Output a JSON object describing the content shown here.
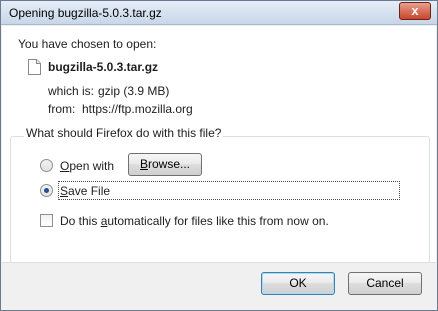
{
  "window": {
    "title": "Opening bugzilla-5.0.3.tar.gz",
    "close_glyph": "x"
  },
  "intro": "You have chosen to open:",
  "file": {
    "name": "bugzilla-5.0.3.tar.gz",
    "which_is_label": "which is:",
    "which_is_value": "gzip (3.9 MB)",
    "from_label": "from:",
    "from_value": "https://ftp.mozilla.org"
  },
  "action_group": {
    "legend": "What should Firefox do with this file?",
    "open_with": {
      "first": "O",
      "rest": "pen with",
      "selected": false
    },
    "browse_button": {
      "first": "B",
      "rest": "rowse..."
    },
    "save_file": {
      "first": "S",
      "rest": "ave File",
      "selected": true
    },
    "auto_checkbox": {
      "before": "Do this ",
      "accel": "a",
      "after": "utomatically for files like this from now on.",
      "checked": false
    }
  },
  "buttons": {
    "ok": "OK",
    "cancel": "Cancel"
  }
}
